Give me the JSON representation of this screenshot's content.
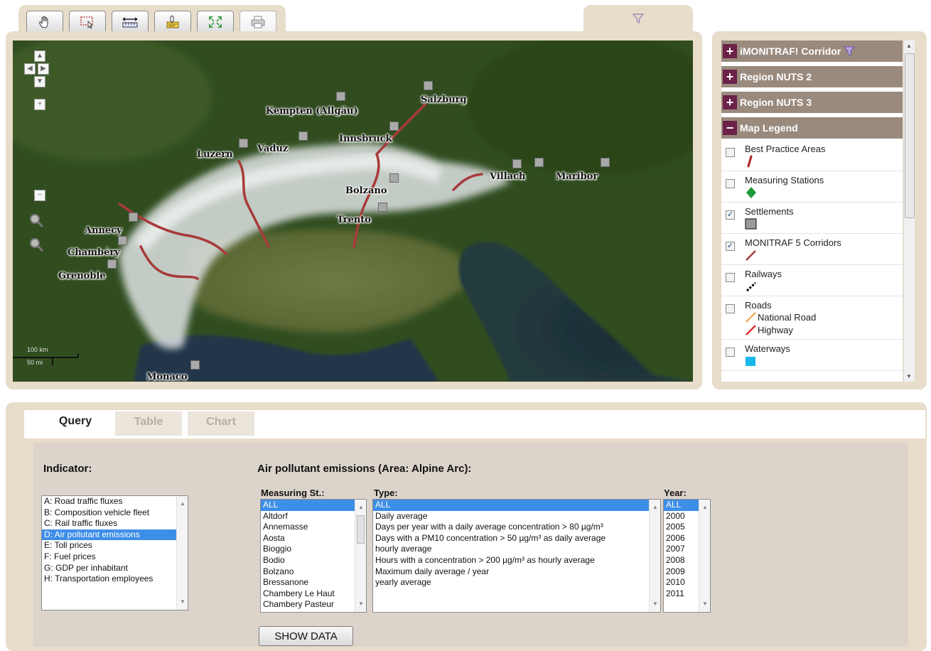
{
  "toolbar": {
    "tools": [
      {
        "name": "pan-tool",
        "icon": "hand-icon"
      },
      {
        "name": "zoom-box-tool",
        "icon": "zoom-box-icon"
      },
      {
        "name": "measure-tool",
        "icon": "measure-icon"
      },
      {
        "name": "identify-tool",
        "icon": "identify-icon"
      },
      {
        "name": "full-extent-tool",
        "icon": "full-extent-icon"
      },
      {
        "name": "print-tool",
        "icon": "printer-icon"
      }
    ]
  },
  "map": {
    "cities": [
      {
        "name": "Salzburg"
      },
      {
        "name": "Kempten (Allgäu)"
      },
      {
        "name": "Innsbruck"
      },
      {
        "name": "Vaduz"
      },
      {
        "name": "Luzern"
      },
      {
        "name": "Villach"
      },
      {
        "name": "Maribor"
      },
      {
        "name": "Bolzano"
      },
      {
        "name": "Trento"
      },
      {
        "name": "Annecy"
      },
      {
        "name": "Chambéry"
      },
      {
        "name": "Grenoble"
      },
      {
        "name": "Monaco"
      }
    ],
    "scale": {
      "km": "100 km",
      "mi": "50 mi"
    }
  },
  "layers": {
    "groups": [
      {
        "label": "iMONITRAF! Corridor",
        "sign": "+"
      },
      {
        "label": "Region NUTS 2",
        "sign": "+"
      },
      {
        "label": "Region NUTS 3",
        "sign": "+"
      },
      {
        "label": "Map Legend",
        "sign": "−"
      }
    ],
    "legend": [
      {
        "label": "Best Practice Areas",
        "checked": false
      },
      {
        "label": "Measuring Stations",
        "checked": false
      },
      {
        "label": "Settlements",
        "checked": true
      },
      {
        "label": "MONITRAF 5 Corridors",
        "checked": true
      },
      {
        "label": "Railways",
        "checked": false
      },
      {
        "label": "Roads",
        "checked": false,
        "sub": [
          "National Road",
          "Highway"
        ]
      },
      {
        "label": "Waterways",
        "checked": false
      }
    ]
  },
  "tabs": [
    "Query",
    "Table",
    "Chart"
  ],
  "query": {
    "indicator_label": "Indicator:",
    "indicators": [
      "A: Road traffic fluxes",
      "B: Composition vehicle fleet",
      "C: Rail traffic fluxes",
      "D: Air pollutant emissions",
      "E: Toll prices",
      "F: Fuel prices",
      "G: GDP per inhabitant",
      "H: Transportation employees"
    ],
    "selected_indicator": 3,
    "section_title": "Air pollutant emissions (Area: Alpine Arc):",
    "stations_label": "Measuring St.:",
    "stations": [
      "ALL",
      "Altdorf",
      "Annemasse",
      "Aosta",
      "Bioggio",
      "Bodio",
      "Bolzano",
      "Bressanone",
      "Chambery Le Haut",
      "Chambery Pasteur"
    ],
    "type_label": "Type:",
    "types": [
      "ALL",
      "Daily average",
      "Days per year with a daily average concentration > 80 µg/m³",
      "Days with a PM10 concentration > 50 µg/m³ as daily average",
      "hourly average",
      "Hours with a concentration > 200 µg/m³ as hourly average",
      "Maximum daily average / year",
      "yearly average"
    ],
    "year_label": "Year:",
    "years": [
      "ALL",
      "2000",
      "2005",
      "2006",
      "2007",
      "2008",
      "2009",
      "2010",
      "2011"
    ],
    "show_button": "SHOW DATA"
  },
  "colors": {
    "panel": "#e8dccb",
    "header": "#9a8a7e",
    "plus_box": "#6b2148",
    "selection": "#3d8ee6",
    "corridor": "#a83a3a"
  }
}
